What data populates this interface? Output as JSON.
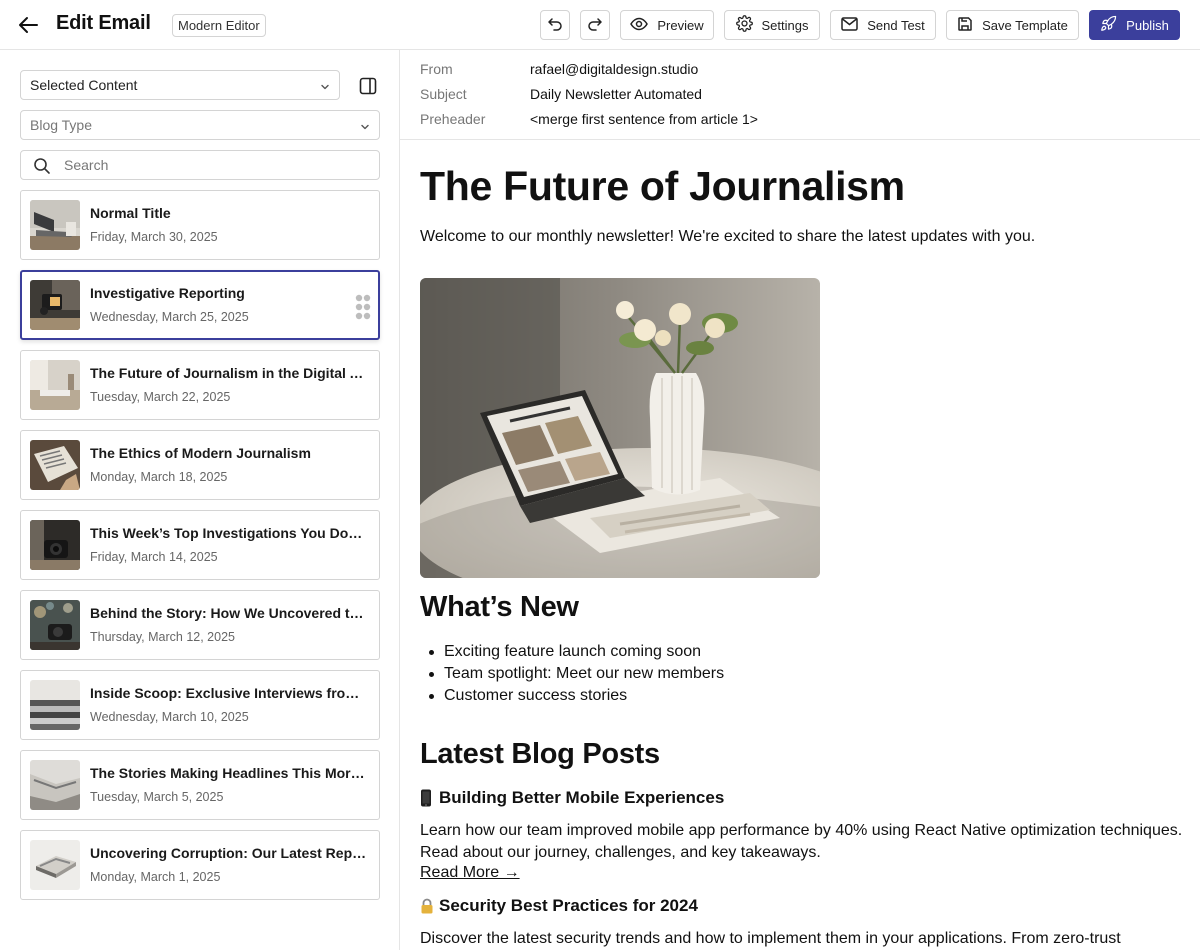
{
  "header": {
    "title": "Edit Email",
    "editor_badge": "Modern Editor",
    "preview_label": "Preview",
    "settings_label": "Settings",
    "send_test_label": "Send Test",
    "save_template_label": "Save Template",
    "publish_label": "Publish"
  },
  "sidebar": {
    "content_select": "Selected Content",
    "type_select": "Blog Type",
    "search_placeholder": "Search",
    "items": [
      {
        "title": "Normal Title",
        "date": "Friday, March 30, 2025"
      },
      {
        "title": "Investigative Reporting",
        "date": "Wednesday, March 25, 2025"
      },
      {
        "title": "The Future of Journalism in the Digital Age",
        "date": "Tuesday, March 22, 2025"
      },
      {
        "title": "The Ethics of Modern Journalism",
        "date": "Monday, March 18, 2025"
      },
      {
        "title": "This Week’s Top Investigations You Don’t Want to Miss",
        "date": "Friday, March 14, 2025"
      },
      {
        "title": "Behind the Story: How We Uncovered the Truth",
        "date": "Thursday, March 12, 2025"
      },
      {
        "title": "Inside Scoop: Exclusive Interviews from the Field",
        "date": "Wednesday, March 10, 2025"
      },
      {
        "title": "The Stories Making Headlines This Morning",
        "date": "Tuesday, March 5, 2025"
      },
      {
        "title": "Uncovering Corruption: Our Latest Report",
        "date": "Monday, March 1, 2025"
      }
    ]
  },
  "email_meta": {
    "from_label": "From",
    "from_value": "rafael@digitaldesign.studio",
    "subject_label": "Subject",
    "subject_value": "Daily Newsletter Automated",
    "preheader_label": "Preheader",
    "preheader_value": "<merge first sentence from article 1>"
  },
  "email_body": {
    "heading": "The Future of Journalism",
    "intro": "Welcome to our monthly newsletter! We're excited to share the latest updates with you.",
    "whats_new_heading": "What’s New",
    "whats_new_items": [
      "Exciting feature launch coming soon",
      "Team spotlight: Meet our new members",
      "Customer success stories"
    ],
    "blog_heading": "Latest Blog Posts",
    "posts": [
      {
        "icon": "phone-icon",
        "title": "Building Better Mobile Experiences",
        "body": "Learn how our team improved mobile app performance by 40% using React Native optimization techniques. Read about our journey, challenges, and key takeaways.",
        "link": "Read More →"
      },
      {
        "icon": "lock-icon",
        "title": "Security Best Practices for 2024",
        "body": "Discover the latest security trends and how to implement them in your applications. From zero-trust"
      }
    ]
  }
}
